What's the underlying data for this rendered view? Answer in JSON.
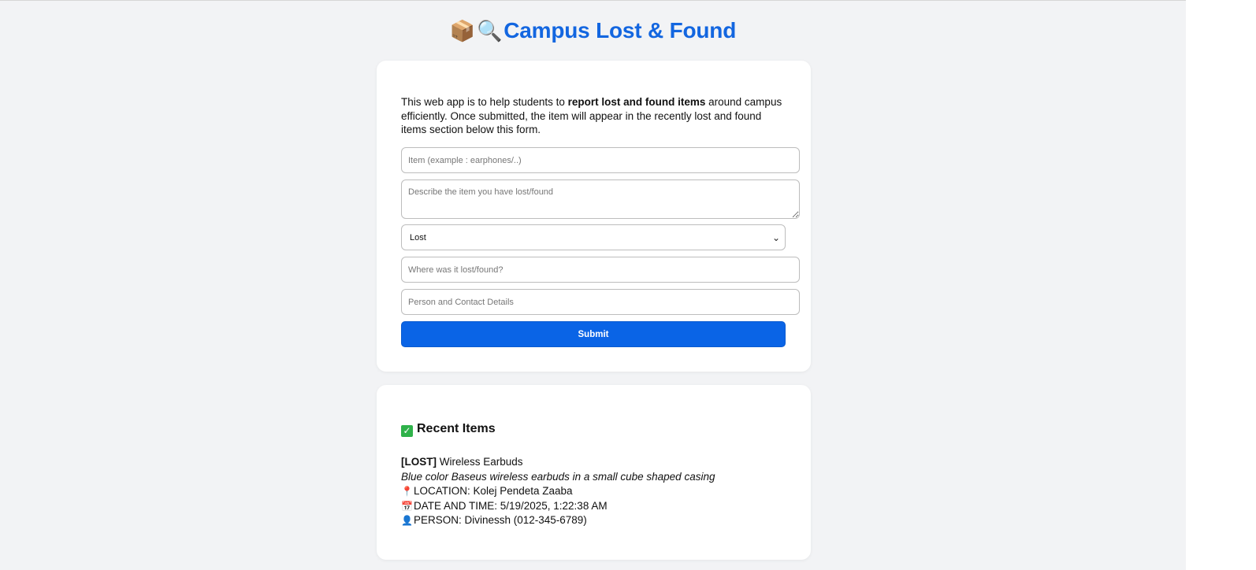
{
  "header": {
    "title": "Campus Lost & Found",
    "icons": [
      "package-icon",
      "magnifier-icon"
    ]
  },
  "form": {
    "intro_before": "This web app is to help students to ",
    "intro_bold": "report lost and found items",
    "intro_after": " around campus efficiently. Once submitted, the item will appear in the recently lost and found items section below this form.",
    "item_placeholder": "Item (example : earphones/..)",
    "description_placeholder": "Describe the item you have lost/found",
    "status_selected": "Lost",
    "location_placeholder": "Where was it lost/found?",
    "contact_placeholder": "Person and Contact Details",
    "submit_label": "Submit"
  },
  "recent": {
    "heading": "Recent Items",
    "items": [
      {
        "tag": "[LOST]",
        "name": " Wireless Earbuds",
        "description": "Blue color Baseus wireless earbuds in a small cube shaped casing",
        "location": "LOCATION: Kolej Pendeta Zaaba",
        "datetime": "DATE AND TIME: 5/19/2025, 1:22:38 AM",
        "person": "PERSON: Divinessh (012-345-6789)"
      }
    ]
  },
  "colors": {
    "accent": "#0a64e6",
    "title": "#1366e0",
    "background": "#f2f3f5"
  }
}
